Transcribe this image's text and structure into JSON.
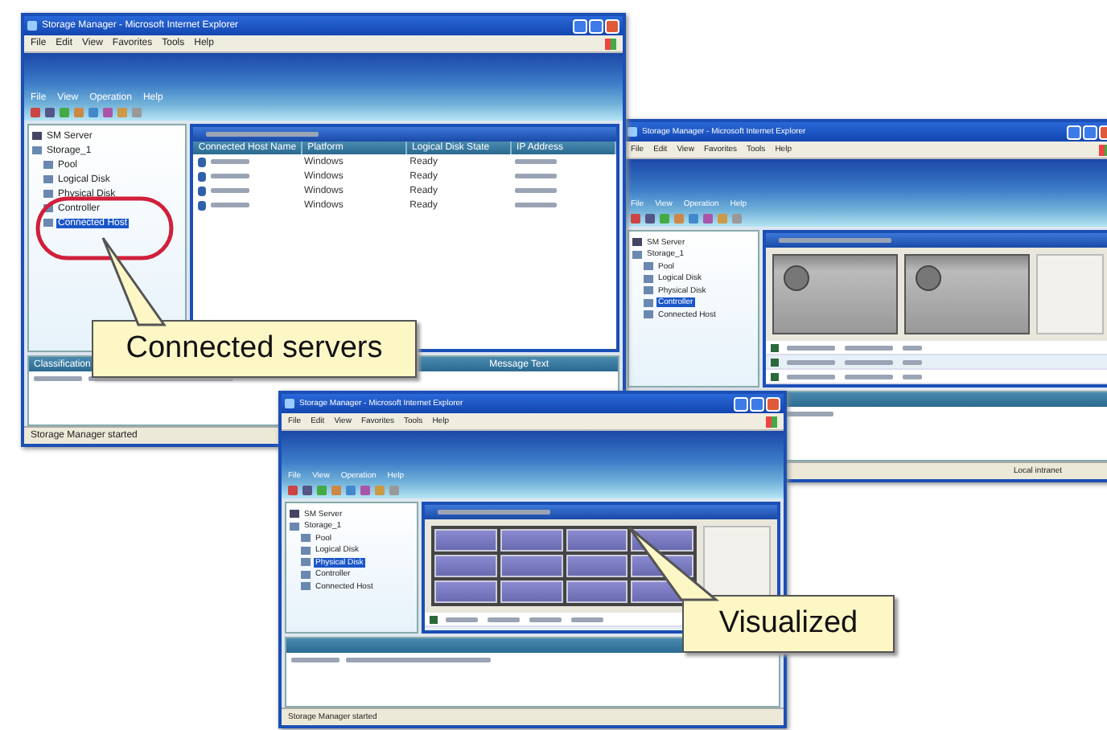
{
  "windows": [
    {
      "title": "Storage Manager - Microsoft Internet Explorer",
      "menu": [
        "File",
        "Edit",
        "View",
        "Favorites",
        "Tools",
        "Help"
      ],
      "app_menu": [
        "File",
        "View",
        "Operation",
        "Help"
      ],
      "tree_root": "SM Server",
      "tree": [
        {
          "label": "Storage_1",
          "selected": false,
          "children": [
            {
              "label": "Pool",
              "selected": false
            },
            {
              "label": "Logical Disk",
              "selected": false
            },
            {
              "label": "Physical Disk",
              "selected": false
            },
            {
              "label": "Controller",
              "selected": false
            },
            {
              "label": "Connected Host",
              "selected": true
            }
          ]
        }
      ],
      "content": {
        "kind": "hosts",
        "columns": [
          "Connected Host Name",
          "Platform",
          "Logical Disk State",
          "IP Address"
        ],
        "rows": [
          {
            "platform": "Windows",
            "state": "Ready"
          },
          {
            "platform": "Windows",
            "state": "Ready"
          },
          {
            "platform": "Windows",
            "state": "Ready"
          },
          {
            "platform": "Windows",
            "state": "Ready"
          }
        ]
      },
      "message_columns": [
        "Classification",
        "Message Text"
      ],
      "status": "Storage Manager started"
    },
    {
      "title": "Storage Manager - Microsoft Internet Explorer",
      "menu": [
        "File",
        "Edit",
        "View",
        "Favorites",
        "Tools",
        "Help"
      ],
      "app_menu": [
        "File",
        "View",
        "Operation",
        "Help"
      ],
      "tree_root": "SM Server",
      "tree": [
        {
          "label": "Storage_1",
          "selected": false,
          "children": [
            {
              "label": "Pool",
              "selected": false
            },
            {
              "label": "Logical Disk",
              "selected": false
            },
            {
              "label": "Physical Disk",
              "selected": false
            },
            {
              "label": "Controller",
              "selected": true
            },
            {
              "label": "Connected Host",
              "selected": false
            }
          ]
        }
      ],
      "content": {
        "kind": "controllers"
      },
      "status": "Local intranet"
    },
    {
      "title": "Storage Manager - Microsoft Internet Explorer",
      "menu": [
        "File",
        "Edit",
        "View",
        "Favorites",
        "Tools",
        "Help"
      ],
      "app_menu": [
        "File",
        "View",
        "Operation",
        "Help"
      ],
      "tree_root": "SM Server",
      "tree": [
        {
          "label": "Storage_1",
          "selected": false,
          "children": [
            {
              "label": "Pool",
              "selected": false
            },
            {
              "label": "Logical Disk",
              "selected": false
            },
            {
              "label": "Physical Disk",
              "selected": true
            },
            {
              "label": "Controller",
              "selected": false
            },
            {
              "label": "Connected Host",
              "selected": false
            }
          ]
        }
      ],
      "content": {
        "kind": "disks"
      },
      "status": "Storage Manager started"
    }
  ],
  "callouts": [
    {
      "text": "Connected servers"
    },
    {
      "text": "Visualized"
    }
  ]
}
